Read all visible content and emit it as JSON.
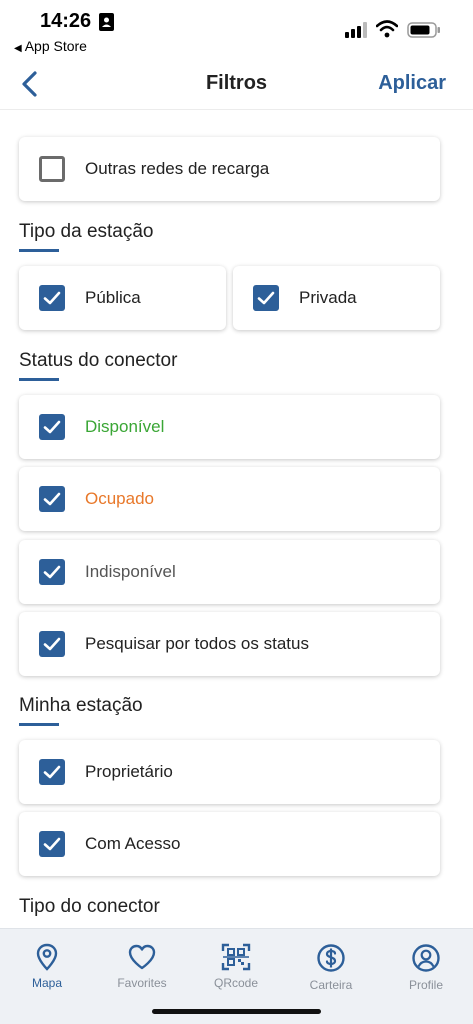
{
  "status_bar": {
    "time": "14:26",
    "back_app": "App Store"
  },
  "nav": {
    "title": "Filtros",
    "apply_label": "Aplicar"
  },
  "other_networks": {
    "label": "Outras redes de recarga",
    "checked": false
  },
  "station_type": {
    "title": "Tipo da estação",
    "options": [
      {
        "label": "Pública",
        "checked": true
      },
      {
        "label": "Privada",
        "checked": true
      }
    ]
  },
  "connector_status": {
    "title": "Status do conector",
    "options": [
      {
        "label": "Disponível",
        "color": "#3aa635",
        "checked": true
      },
      {
        "label": "Ocupado",
        "color": "#e8782a",
        "checked": true
      },
      {
        "label": "Indisponível",
        "color": "#555555",
        "checked": true
      },
      {
        "label": "Pesquisar por todos os status",
        "color": "#222222",
        "checked": true
      }
    ]
  },
  "my_station": {
    "title": "Minha estação",
    "options": [
      {
        "label": "Proprietário",
        "checked": true
      },
      {
        "label": "Com Acesso",
        "checked": true
      }
    ]
  },
  "connector_type": {
    "title": "Tipo do conector"
  },
  "colors": {
    "accent": "#2d5f99",
    "inactive_tab": "#8a9099",
    "tabbar_bg": "#eef1f5"
  },
  "tabbar": {
    "items": [
      {
        "label": "Mapa",
        "icon": "map-pin-icon",
        "active": true
      },
      {
        "label": "Favorites",
        "icon": "heart-icon",
        "active": false
      },
      {
        "label": "QRcode",
        "icon": "qrcode-icon",
        "active": false
      },
      {
        "label": "Carteira",
        "icon": "dollar-icon",
        "active": false
      },
      {
        "label": "Profile",
        "icon": "user-icon",
        "active": false
      }
    ]
  }
}
